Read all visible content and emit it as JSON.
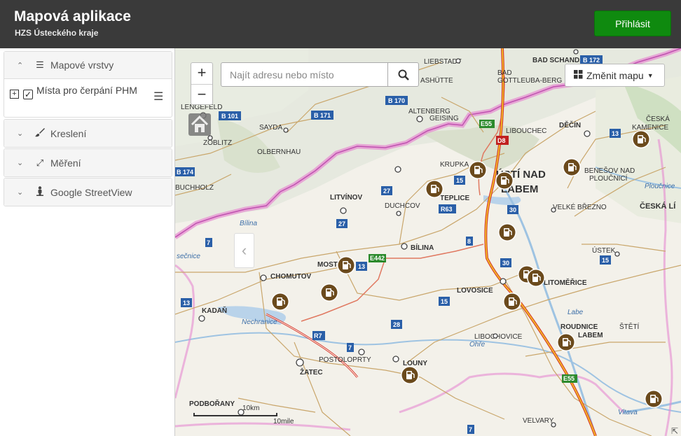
{
  "header": {
    "title": "Mapová aplikace",
    "subtitle": "HZS Ústeckého kraje",
    "login_label": "Přihlásit"
  },
  "sidebar": {
    "panels": [
      {
        "label": "Mapové vrstvy",
        "icon": "list-icon",
        "expanded": true
      },
      {
        "label": "Kreslení",
        "icon": "brush-icon",
        "expanded": false
      },
      {
        "label": "Měření",
        "icon": "resize-arrows-icon",
        "expanded": false
      },
      {
        "label": "Google StreetView",
        "icon": "pegman-icon",
        "expanded": false
      }
    ],
    "layer": {
      "name": "Místa pro čerpání PHM",
      "checked": true
    }
  },
  "map": {
    "search_placeholder": "Najít adresu nebo místo",
    "basemap_label": "Změnit mapu",
    "zoom_in": "+",
    "zoom_out": "−",
    "scale_top": "10km",
    "scale_bottom": "10mile",
    "places": [
      "BAD SCHANDAU",
      "LIEBSTADT",
      "ASHÜTTE",
      "BAD GOTTLEUBA-BERGGIESSHÜBEL",
      "ALTENBERG",
      "GEISING",
      "LENGEFELD",
      "SAYDA",
      "ZÖBLITZ",
      "OLBERNHAU",
      "BUCHHOLZ",
      "LIBOUCHEC",
      "DĚČÍN",
      "ČESKÁ KAMENICE",
      "KRUPKA",
      "ÚSTÍ NAD LABEM",
      "BENEŠOV NAD PLOUČNICÍ",
      "LITVÍNOV",
      "DUCHCOV",
      "TEPLICE",
      "VELKÉ BŘEZNO",
      "ČESKÁ LÍPA",
      "BÍLINA",
      "ÚSTEK",
      "MOST",
      "CHOMUTOV",
      "LOVOSICE",
      "LITOMĚŘICE",
      "KADAŇ",
      "Nechranice",
      "LIBOCHOVICE",
      "ROUDNICE NAD LABEM",
      "ŠTĚTÍ",
      "POSTOLOPRTY",
      "LOUNY",
      "ŽATEC",
      "PODBOŘANY",
      "VELVARY",
      "Bílina",
      "Ohře",
      "Vltava",
      "Ploučnice",
      "Labe"
    ],
    "road_labels": [
      "B 172",
      "B 101",
      "B 171",
      "B 170",
      "B 174",
      "E55",
      "D8",
      "R63",
      "R7",
      "E442",
      "27",
      "13",
      "15",
      "30",
      "28",
      "7",
      "8"
    ],
    "fuel_station_count": 16
  }
}
